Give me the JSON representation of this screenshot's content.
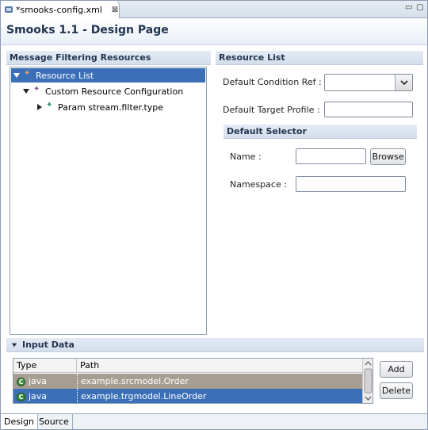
{
  "editor_tab": {
    "title": "*smooks-config.xml",
    "close_glyph": "⊠"
  },
  "window_controls": {
    "minimize": "▭",
    "maximize": "▢"
  },
  "header": {
    "title": "Smooks 1.1 - Design Page"
  },
  "left_section": {
    "title": "Message Filtering Resources",
    "tree": [
      {
        "label": "Resource List",
        "expanded": true,
        "selected": true,
        "icon": "resource-list-icon"
      },
      {
        "label": "Custom Resource Configuration",
        "expanded": true,
        "selected": false,
        "icon": "config-icon"
      },
      {
        "label": "Param stream.filter.type",
        "expanded": false,
        "selected": false,
        "icon": "param-icon"
      }
    ]
  },
  "right_section": {
    "title": "Resource List",
    "default_condition_label": "Default Condition Ref :",
    "default_condition_value": "",
    "default_target_label": "Default Target Profile :",
    "default_target_value": "",
    "default_selector": {
      "title": "Default Selector",
      "name_label": "Name :",
      "name_value": "",
      "browse_label": "Browse",
      "namespace_label": "Namespace :",
      "namespace_value": ""
    }
  },
  "input_data": {
    "title": "Input Data",
    "columns": [
      "Type",
      "Path"
    ],
    "rows": [
      {
        "type": "java",
        "path": "example.srcmodel.Order",
        "selected": false
      },
      {
        "type": "java",
        "path": "example.trgmodel.LineOrder",
        "selected": true
      }
    ],
    "add_label": "Add",
    "delete_label": "Delete"
  },
  "bottom_tabs": [
    "Design",
    "Source"
  ],
  "colors": {
    "selection": "#3b6fb8",
    "row_inactive": "#a79e93",
    "header_text": "#20344f"
  }
}
